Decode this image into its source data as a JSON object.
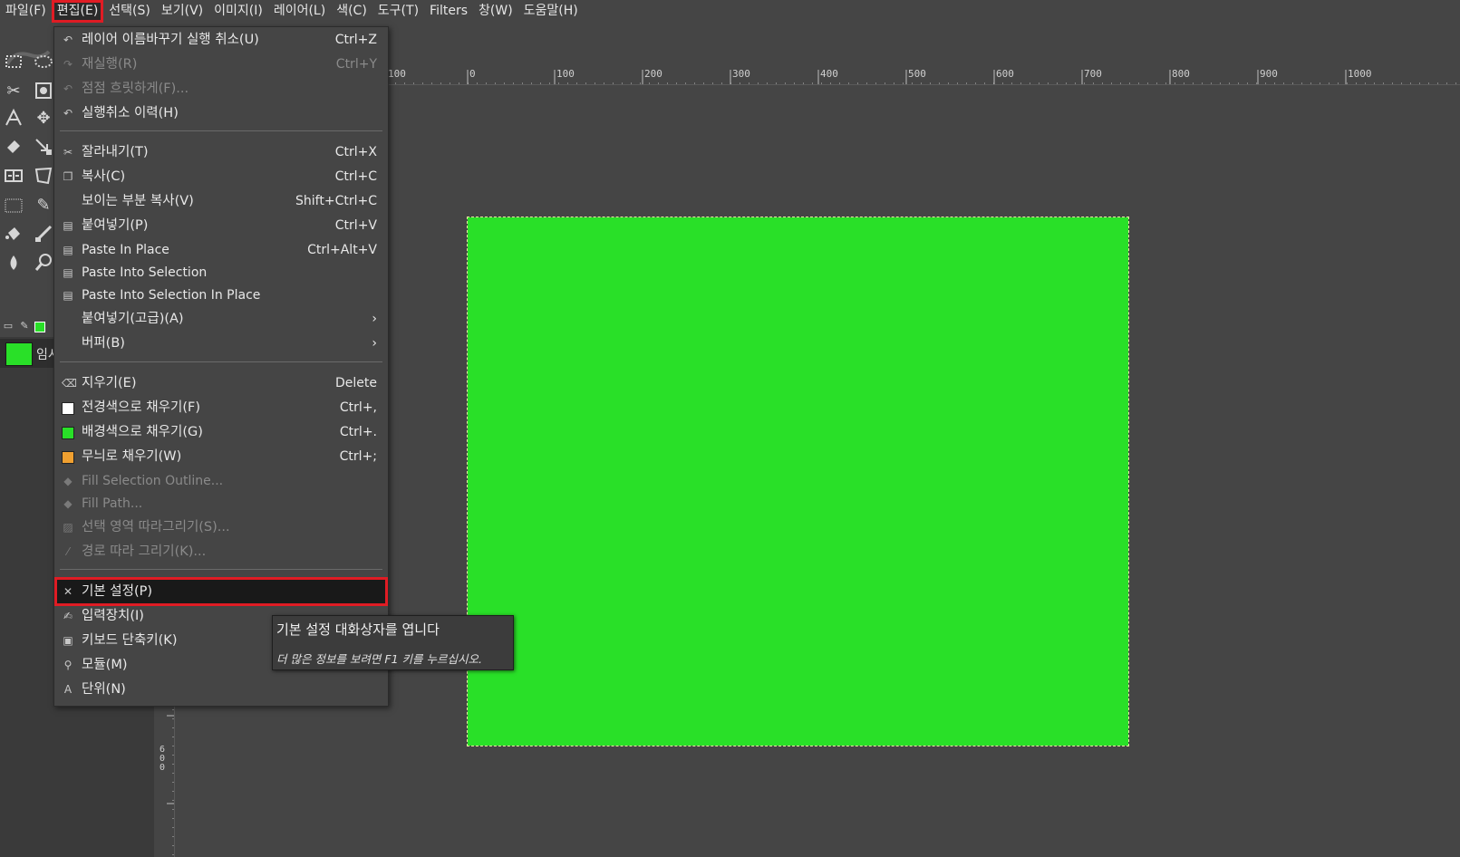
{
  "menubar": {
    "items": [
      {
        "label": "파일(F)"
      },
      {
        "label": "편집(E)"
      },
      {
        "label": "선택(S)"
      },
      {
        "label": "보기(V)"
      },
      {
        "label": "이미지(I)"
      },
      {
        "label": "레이어(L)"
      },
      {
        "label": "색(C)"
      },
      {
        "label": "도구(T)"
      },
      {
        "label": "Filters"
      },
      {
        "label": "창(W)"
      },
      {
        "label": "도움말(H)"
      }
    ],
    "active_index": 1
  },
  "edit_menu": {
    "undo": {
      "label": "레이어 이름바꾸기 실행 취소(U)",
      "shortcut": "Ctrl+Z",
      "icon": "undo-icon"
    },
    "redo": {
      "label": "재실행(R)",
      "shortcut": "Ctrl+Y",
      "icon": "redo-icon"
    },
    "fade": {
      "label": "점점 흐릿하게(F)...",
      "icon": "fade-icon"
    },
    "undo_history": {
      "label": "실행취소 이력(H)",
      "icon": "history-icon"
    },
    "cut": {
      "label": "잘라내기(T)",
      "shortcut": "Ctrl+X",
      "icon": "scissors-icon"
    },
    "copy": {
      "label": "복사(C)",
      "shortcut": "Ctrl+C",
      "icon": "copy-icon"
    },
    "copy_visible": {
      "label": "보이는 부분 복사(V)",
      "shortcut": "Shift+Ctrl+C"
    },
    "paste": {
      "label": "붙여넣기(P)",
      "shortcut": "Ctrl+V",
      "icon": "paste-icon"
    },
    "paste_in_place": {
      "label": "Paste In Place",
      "shortcut": "Ctrl+Alt+V",
      "icon": "paste-icon"
    },
    "paste_into_selection": {
      "label": "Paste Into Selection",
      "icon": "paste-icon"
    },
    "paste_into_selection_in_place": {
      "label": "Paste Into Selection In Place",
      "icon": "paste-icon"
    },
    "paste_as": {
      "label": "붙여넣기(고급)(A)"
    },
    "buffer": {
      "label": "버퍼(B)"
    },
    "clear": {
      "label": "지우기(E)",
      "shortcut": "Delete",
      "icon": "eraser-icon"
    },
    "fill_fg": {
      "label": "전경색으로 채우기(F)",
      "shortcut": "Ctrl+,",
      "swatch": "#ffffff"
    },
    "fill_bg": {
      "label": "배경색으로 채우기(G)",
      "shortcut": "Ctrl+.",
      "swatch": "#29e028"
    },
    "fill_pattern": {
      "label": "무늬로 채우기(W)",
      "shortcut": "Ctrl+;",
      "swatch": "#f0a030"
    },
    "fill_selection_outline": {
      "label": "Fill Selection Outline...",
      "icon": "bucket-icon"
    },
    "fill_path": {
      "label": "Fill Path...",
      "icon": "bucket-icon"
    },
    "stroke_selection": {
      "label": "선택 영역 따라그리기(S)...",
      "icon": "stroke-icon"
    },
    "stroke_path": {
      "label": "경로 따라 그리기(K)...",
      "icon": "stroke-path-icon"
    },
    "preferences": {
      "label": "기본 설정(P)",
      "icon": "preferences-icon"
    },
    "input_devices": {
      "label": "입력장치(I)",
      "icon": "input-device-icon"
    },
    "keyboard_shortcuts": {
      "label": "키보드 단축키(K)",
      "icon": "keyboard-icon"
    },
    "modules": {
      "label": "모듈(M)",
      "icon": "plugin-icon"
    },
    "units": {
      "label": "단위(N)",
      "icon": "ruler-icon"
    }
  },
  "tooltip": {
    "title": "기본 설정 대화상자를 엽니다",
    "hint": "더 많은 정보를 보려면 F1 키를 누르십시오."
  },
  "layers": {
    "name": "임시"
  },
  "rulers": {
    "h_labels": [
      "100",
      "0",
      "100",
      "200",
      "300",
      "400",
      "500",
      "600",
      "700",
      "800",
      "900",
      "1000"
    ],
    "v_label": "600"
  },
  "colors": {
    "canvas_fill": "#29e028",
    "highlight_border": "#e01c24",
    "ui_background": "#454545"
  }
}
